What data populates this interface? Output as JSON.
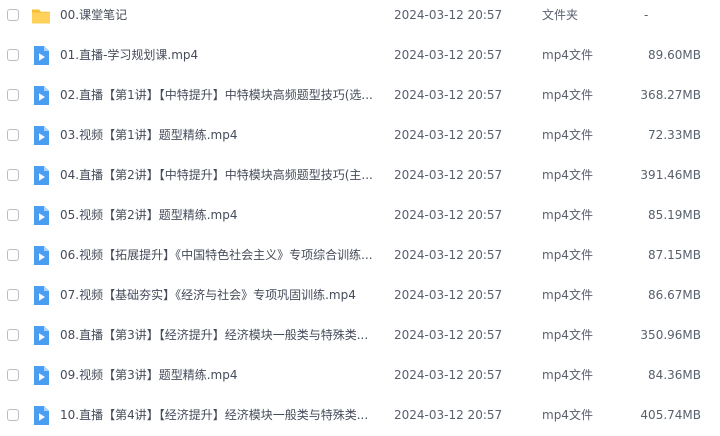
{
  "colors": {
    "folder": "#f7c84a",
    "video": "#4a9ef2",
    "text": "#454b5a"
  },
  "files": [
    {
      "name": "00.课堂笔记",
      "date": "2024-03-12 20:57",
      "type": "文件夹",
      "size": "-",
      "icon": "folder-icon"
    },
    {
      "name": "01.直播-学习规划课.mp4",
      "date": "2024-03-12 20:57",
      "type": "mp4文件",
      "size": "89.60MB",
      "icon": "video-file-icon"
    },
    {
      "name": "02.直播【第1讲】【中特提升】中特模块高频题型技巧(选...",
      "date": "2024-03-12 20:57",
      "type": "mp4文件",
      "size": "368.27MB",
      "icon": "video-file-icon"
    },
    {
      "name": "03.视频【第1讲】题型精练.mp4",
      "date": "2024-03-12 20:57",
      "type": "mp4文件",
      "size": "72.33MB",
      "icon": "video-file-icon"
    },
    {
      "name": "04.直播【第2讲】【中特提升】中特模块高频题型技巧(主...",
      "date": "2024-03-12 20:57",
      "type": "mp4文件",
      "size": "391.46MB",
      "icon": "video-file-icon"
    },
    {
      "name": "05.视频【第2讲】题型精练.mp4",
      "date": "2024-03-12 20:57",
      "type": "mp4文件",
      "size": "85.19MB",
      "icon": "video-file-icon"
    },
    {
      "name": "06.视频【拓展提升】《中国特色社会主义》专项综合训练...",
      "date": "2024-03-12 20:57",
      "type": "mp4文件",
      "size": "87.15MB",
      "icon": "video-file-icon"
    },
    {
      "name": "07.视频【基础夯实】《经济与社会》专项巩固训练.mp4",
      "date": "2024-03-12 20:57",
      "type": "mp4文件",
      "size": "86.67MB",
      "icon": "video-file-icon"
    },
    {
      "name": "08.直播【第3讲】【经济提升】经济模块一般类与特殊类...",
      "date": "2024-03-12 20:57",
      "type": "mp4文件",
      "size": "350.96MB",
      "icon": "video-file-icon"
    },
    {
      "name": "09.视频【第3讲】题型精练.mp4",
      "date": "2024-03-12 20:57",
      "type": "mp4文件",
      "size": "84.36MB",
      "icon": "video-file-icon"
    },
    {
      "name": "10.直播【第4讲】【经济提升】经济模块一般类与特殊类...",
      "date": "2024-03-12 20:57",
      "type": "mp4文件",
      "size": "405.74MB",
      "icon": "video-file-icon"
    }
  ]
}
